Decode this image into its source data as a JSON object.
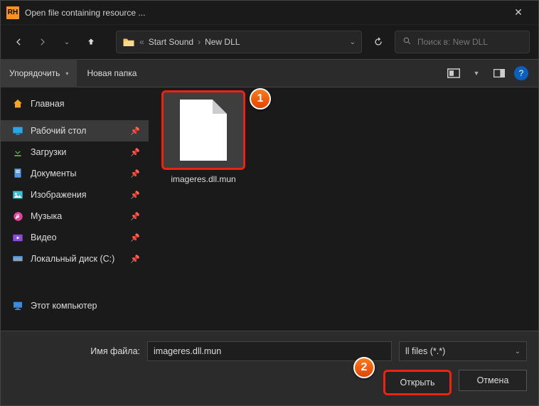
{
  "window": {
    "title": "Open file containing resource ..."
  },
  "nav": {
    "crumbs": [
      "Start Sound",
      "New DLL"
    ],
    "search_placeholder": "Поиск в: New DLL"
  },
  "toolbar": {
    "organize": "Упорядочить",
    "new_folder": "Новая папка"
  },
  "sidebar": {
    "home": "Главная",
    "desktop": "Рабочий стол",
    "downloads": "Загрузки",
    "documents": "Документы",
    "pictures": "Изображения",
    "music": "Музыка",
    "video": "Видео",
    "local_disk": "Локальный диск (C:)",
    "this_pc": "Этот компьютер"
  },
  "file": {
    "name": "imageres.dll.mun"
  },
  "bottom": {
    "filename_label": "Имя файла:",
    "filename_value": "imageres.dll.mun",
    "filter": "ll files (*.*)",
    "open": "Открыть",
    "cancel": "Отмена"
  },
  "callouts": {
    "b1": "1",
    "b2": "2"
  }
}
